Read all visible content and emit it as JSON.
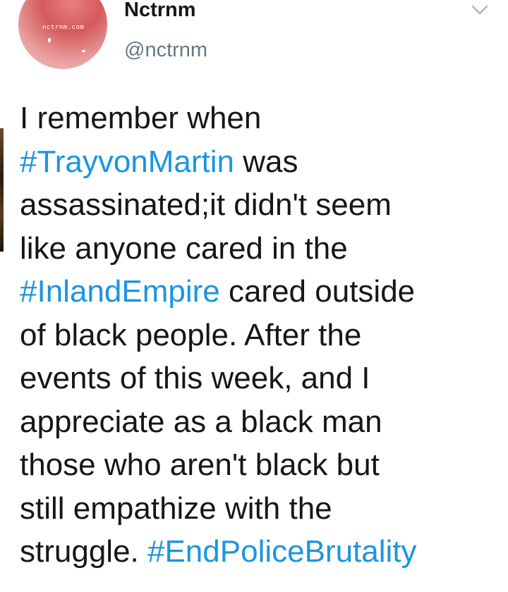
{
  "user": {
    "avatar_text": "nctrnm.com",
    "display_name": "Nctrnm",
    "handle": "@nctrnm"
  },
  "tweet": {
    "lines": [
      [
        {
          "text": "I remember when",
          "type": "text"
        }
      ],
      [
        {
          "text": "#TrayvonMartin",
          "type": "hashtag"
        },
        {
          "text": " was",
          "type": "text"
        }
      ],
      [
        {
          "text": "assassinated;it didn't seem",
          "type": "text"
        }
      ],
      [
        {
          "text": "like anyone cared in the",
          "type": "text"
        }
      ],
      [
        {
          "text": "#InlandEmpire",
          "type": "hashtag"
        },
        {
          "text": " cared outside",
          "type": "text"
        }
      ],
      [
        {
          "text": "of black people. After the",
          "type": "text"
        }
      ],
      [
        {
          "text": "events of this week, and I",
          "type": "text"
        }
      ],
      [
        {
          "text": "appreciate as a black man",
          "type": "text"
        }
      ],
      [
        {
          "text": "those who aren't black but",
          "type": "text"
        }
      ],
      [
        {
          "text": "still empathize with the",
          "type": "text"
        }
      ],
      [
        {
          "text": "struggle. ",
          "type": "text"
        },
        {
          "text": "#EndPoliceBrutality",
          "type": "hashtag"
        }
      ]
    ]
  },
  "icons": {
    "menu": "chevron-down-icon"
  },
  "colors": {
    "hashtag": "#1b95e0",
    "text": "#14171a",
    "handle": "#657786",
    "caret": "#aab8c2"
  }
}
